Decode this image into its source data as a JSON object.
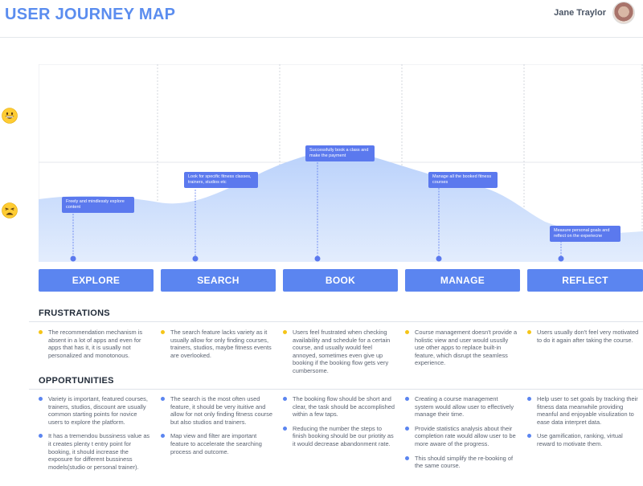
{
  "header": {
    "title": "USER JOURNEY MAP",
    "user_name": "Jane Traylor"
  },
  "emotions": {
    "happy_icon": "grinning-face-icon",
    "sad_icon": "weary-face-icon"
  },
  "colors": {
    "accent": "#5b85f0",
    "curve_fill": "#cfe0fb",
    "frustration_dot": "#f5c518",
    "opportunity_dot": "#5b85f0"
  },
  "stages": [
    {
      "label": "EXPLORE",
      "callout": "Freely and mindlessly explore content"
    },
    {
      "label": "SEARCH",
      "callout": "Look for specific fitness classes, trainers, studios etc"
    },
    {
      "label": "BOOK",
      "callout": "Successfully book a class and make the payment"
    },
    {
      "label": "MANAGE",
      "callout": "Manage all the booked fitness courses"
    },
    {
      "label": "REFLECT",
      "callout": "Measure personal goals and reflect on the experiecne"
    }
  ],
  "frustrations": {
    "title": "FRUSTRATIONS",
    "items": [
      "The recommendation mechanism is absent in a lot of apps and even for apps that has it, it is usually not personalized and monotonous.",
      "The search feature lacks variety as it usually allow for only finding courses, trainers, studios, maybe fitness events are overlooked.",
      "Users feel frustrated when checking availability and schedule for a certain course,  and usually would feel annoyed, sometimes even give up booking if the booking flow gets very cumbersome.",
      "Course management doesn't provide a holistic view and user would ususlly use other apps to replace built-in feature, which disrupt the seamless experience.",
      "Users usually don't feel very motivated to do it again after taking the course."
    ]
  },
  "opportunities": {
    "title": "OPPORTUNITIES",
    "columns": [
      [
        "Variety is important, featured courses, trainers, studios, discount are usually common starting points for novice users to explore the platform.",
        "It has a tremendou bussiness value as it creates plenty t entry point for booking, it should increase the exposure for different bussiness models(studio or personal trainer)."
      ],
      [
        "The search is the most often used feature, it should be very ituitive and allow for not only finding fitness course but also studios and trainers.",
        "Map view and filter are important feature to accelerate the searching process and outcome."
      ],
      [
        "The booking flow should be short and clear, the task should be accomplished within a few taps.",
        "Reducing the number the steps to finish booking should be our priotity as it would decrease abandonment rate."
      ],
      [
        "Creating a course management system would allow user to effectively manage their time.",
        "Provide statistics analysis about their completion rate would allow user to be more aware of the progress.",
        "This should simplify the re-booking of the same course."
      ],
      [
        "Help user to set goals by tracking their fitness data meanwhile providing meanful and enjoyable visulization to ease data interpret data.",
        "Use gamification, ranking, virtual reward to motivate them."
      ]
    ]
  }
}
